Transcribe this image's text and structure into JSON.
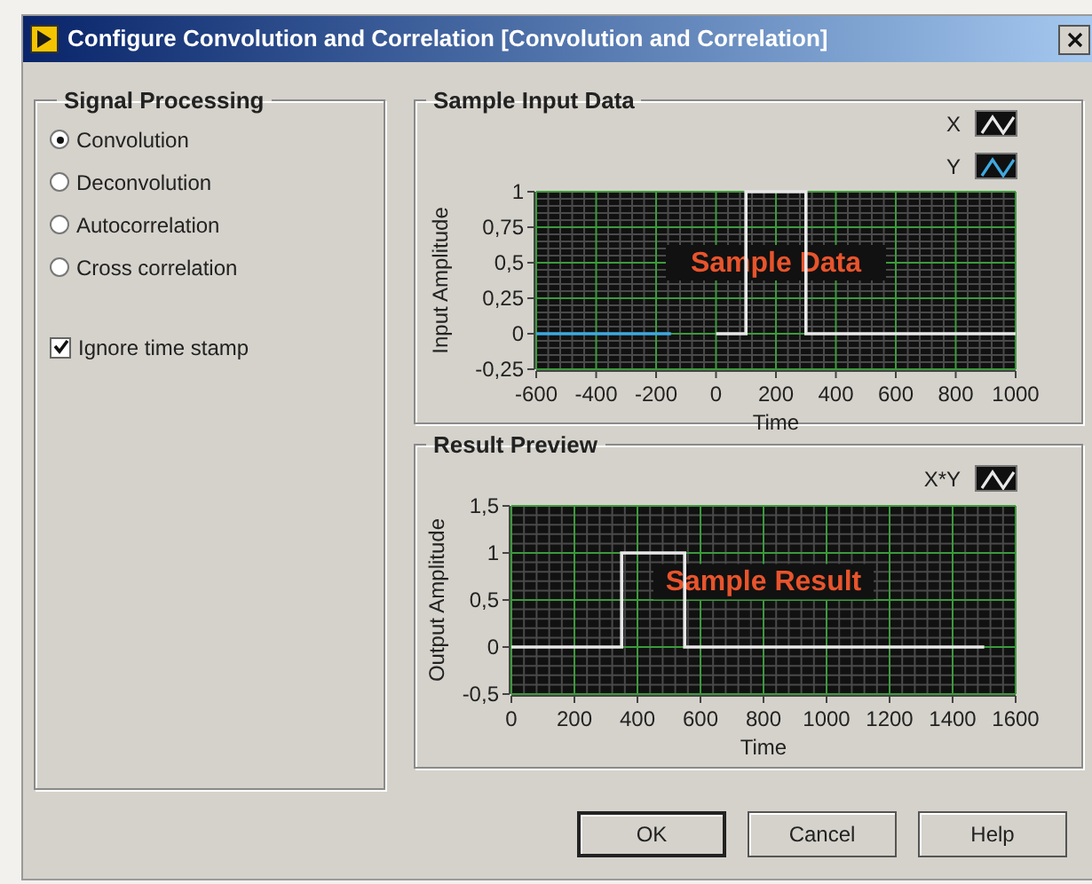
{
  "window": {
    "title": "Configure Convolution and Correlation [Convolution and Correlation]"
  },
  "signal_processing": {
    "title": "Signal Processing",
    "options": [
      {
        "label": "Convolution",
        "selected": true
      },
      {
        "label": "Deconvolution",
        "selected": false
      },
      {
        "label": "Autocorrelation",
        "selected": false
      },
      {
        "label": "Cross correlation",
        "selected": false
      }
    ],
    "ignore_time_stamp": {
      "label": "Ignore time stamp",
      "checked": true
    }
  },
  "sample_input": {
    "title": "Sample Input Data",
    "chart_data": {
      "type": "line",
      "xlabel": "Time",
      "ylabel": "Input Amplitude",
      "x": [
        -600,
        -250,
        -150,
        0,
        100,
        100,
        300,
        300,
        1000
      ],
      "series": [
        {
          "name": "X",
          "color": "#e8e8e8",
          "values": [
            null,
            null,
            null,
            0,
            0,
            1,
            1,
            0,
            0
          ]
        },
        {
          "name": "Y",
          "color": "#3fa9e0",
          "values": [
            0,
            0,
            0,
            null,
            null,
            null,
            null,
            null,
            null
          ]
        }
      ],
      "xlim": [
        -600,
        1000
      ],
      "ylim": [
        -0.25,
        1
      ],
      "xticks": [
        -600,
        -400,
        -200,
        0,
        200,
        400,
        600,
        800,
        1000
      ],
      "yticks": [
        {
          "value": -0.25,
          "label": "-0,25"
        },
        {
          "value": 0,
          "label": "0"
        },
        {
          "value": 0.25,
          "label": "0,25"
        },
        {
          "value": 0.5,
          "label": "0,5"
        },
        {
          "value": 0.75,
          "label": "0,75"
        },
        {
          "value": 1,
          "label": "1"
        }
      ],
      "annotations": [
        "Sample Data"
      ],
      "grid": true
    }
  },
  "result_preview": {
    "title": "Result Preview",
    "chart_data": {
      "type": "line",
      "xlabel": "Time",
      "ylabel": "Output Amplitude",
      "x": [
        0,
        350,
        350,
        550,
        550,
        1500
      ],
      "series": [
        {
          "name": "X*Y",
          "color": "#e8e8e8",
          "values": [
            0,
            0,
            1,
            1,
            0,
            0
          ]
        }
      ],
      "xlim": [
        0,
        1600
      ],
      "ylim": [
        -0.5,
        1.5
      ],
      "xticks": [
        0,
        200,
        400,
        600,
        800,
        1000,
        1200,
        1400,
        1600
      ],
      "yticks": [
        {
          "value": -0.5,
          "label": "-0,5"
        },
        {
          "value": 0,
          "label": "0"
        },
        {
          "value": 0.5,
          "label": "0,5"
        },
        {
          "value": 1,
          "label": "1"
        },
        {
          "value": 1.5,
          "label": "1,5"
        }
      ],
      "annotations": [
        "Sample Result"
      ],
      "grid": true
    }
  },
  "buttons": [
    "OK",
    "Cancel",
    "Help"
  ]
}
